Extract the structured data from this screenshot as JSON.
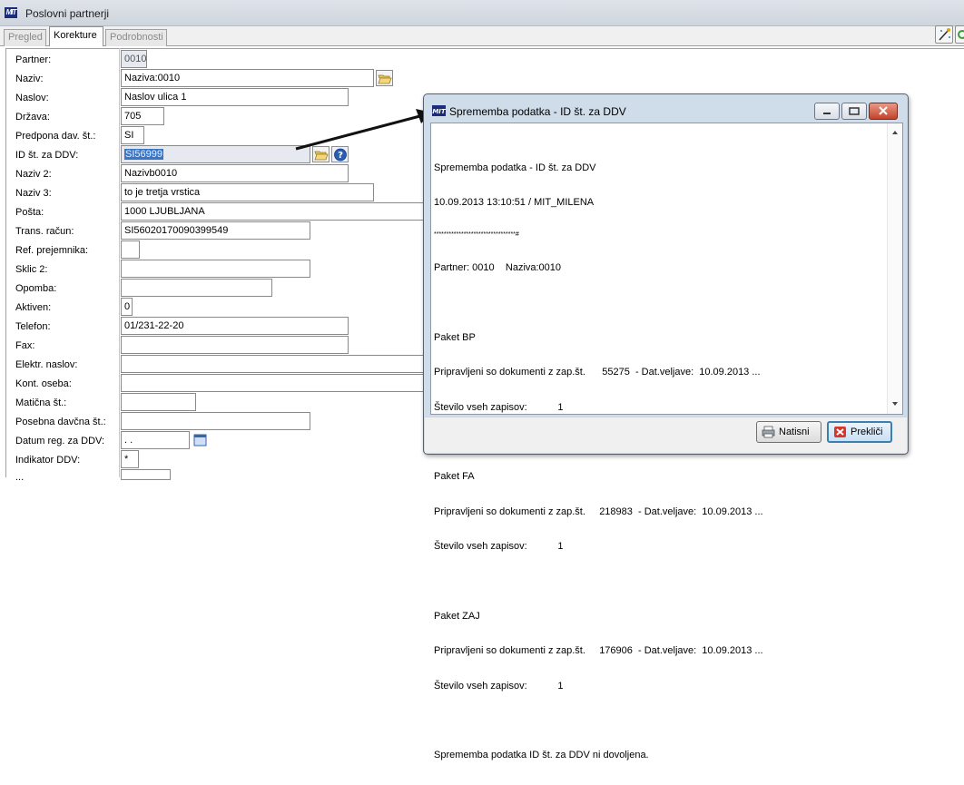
{
  "window": {
    "title": "Poslovni partnerji"
  },
  "tabs": [
    {
      "label": "Pregled",
      "active": false
    },
    {
      "label": "Korekture",
      "active": true
    },
    {
      "label": "Podrobnosti",
      "active": false
    }
  ],
  "toolbar": {
    "icons": [
      "magic-wand-icon",
      "refresh-icon"
    ]
  },
  "form": {
    "rows": [
      {
        "label": "Partner:",
        "value": "0010"
      },
      {
        "label": "Naziv:",
        "value": "Naziva:0010"
      },
      {
        "label": "Naslov:",
        "value": "Naslov ulica 1"
      },
      {
        "label": "Država:",
        "value": "705"
      },
      {
        "label": "Predpona dav. št.:",
        "value": "SI"
      },
      {
        "label": "ID št. za DDV:",
        "value": "SI56999"
      },
      {
        "label": "Naziv 2:",
        "value": "Nazivb0010"
      },
      {
        "label": "Naziv 3:",
        "value": "to je tretja vrstica"
      },
      {
        "label": "Pošta:",
        "value": "1000 LJUBLJANA"
      },
      {
        "label": "Trans. račun:",
        "value": "SI56020170090399549"
      },
      {
        "label": "Ref. prejemnika:",
        "value": ""
      },
      {
        "label": "Sklic 2:",
        "value": ""
      },
      {
        "label": "Opomba:",
        "value": ""
      },
      {
        "label": "Aktiven:",
        "value": "0"
      },
      {
        "label": "Telefon:",
        "value": "01/231-22-20"
      },
      {
        "label": "Fax:",
        "value": ""
      },
      {
        "label": "Elektr. naslov:",
        "value": ""
      },
      {
        "label": "Kont. oseba:",
        "value": ""
      },
      {
        "label": "Matična št.:",
        "value": ""
      },
      {
        "label": "Posebna davčna št.:",
        "value": ""
      },
      {
        "label": "Datum reg. za DDV:",
        "value": "  .  .  "
      },
      {
        "label": "Indikator DDV:",
        "value": "*"
      }
    ]
  },
  "dialog": {
    "title": "Sprememba podatka - ID št. za DDV",
    "lines": [
      "Sprememba podatka - ID št. za DDV",
      "10.09.2013 13:10:51 / MIT_MILENA",
      "*********************************#",
      "Partner: 0010    Naziva:0010",
      "",
      "Paket BP",
      "Pripravljeni so dokumenti z zap.št.      55275  - Dat.veljave:  10.09.2013 ...",
      "Število vseh zapisov:           1",
      "",
      "Paket FA",
      "Pripravljeni so dokumenti z zap.št.     218983  - Dat.veljave:  10.09.2013 ...",
      "Število vseh zapisov:           1",
      "",
      "Paket ZAJ",
      "Pripravljeni so dokumenti z zap.št.     176906  - Dat.veljave:  10.09.2013 ...",
      "Število vseh zapisov:           1",
      "",
      "Sprememba podatka ID št. za DDV ni dovoljena."
    ],
    "buttons": {
      "print": "Natisni",
      "cancel": "Prekliči"
    }
  }
}
